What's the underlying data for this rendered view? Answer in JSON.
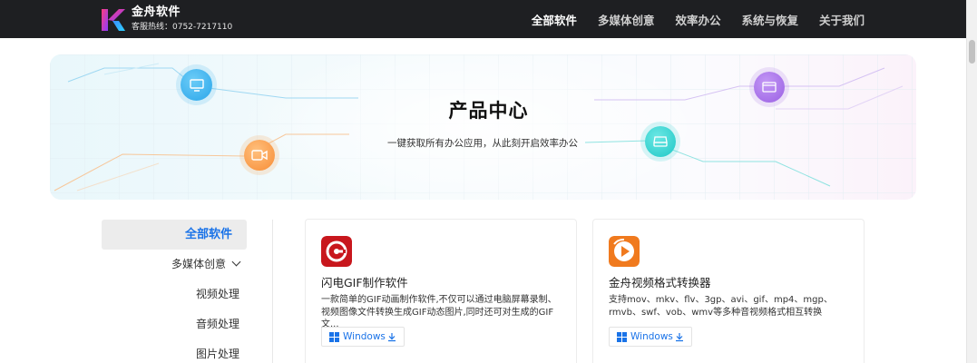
{
  "header": {
    "brand_name": "金舟软件",
    "hotline": "客服热线：0752-7217110",
    "nav": [
      "全部软件",
      "多媒体创意",
      "效率办公",
      "系统与恢复",
      "关于我们"
    ]
  },
  "banner": {
    "title": "产品中心",
    "subtitle": "一键获取所有办公应用，从此刻开启效率办公",
    "bubbles": [
      {
        "icon": "monitor-icon",
        "color": "#3db3ee"
      },
      {
        "icon": "video-camera-icon",
        "color": "#fb9a43"
      },
      {
        "icon": "hard-drive-icon",
        "color": "#2ed2d0"
      },
      {
        "icon": "browser-window-icon",
        "color": "#a56ee6"
      }
    ]
  },
  "sidebar": {
    "items": [
      {
        "label": "全部软件"
      },
      {
        "label": "多媒体创意"
      },
      {
        "label": "视频处理"
      },
      {
        "label": "音频处理"
      },
      {
        "label": "图片处理"
      }
    ]
  },
  "products": [
    {
      "title": "闪电GIF制作软件",
      "desc": "一款简单的GIF动画制作软件,不仅可以通过电脑屏幕录制、视频图像文件转换生成GIF动态图片,同时还可对生成的GIF文...",
      "download_label": "Windows",
      "icon": "gif-maker-app-icon",
      "icon_color": "#c8171d"
    },
    {
      "title": "金舟视频格式转换器",
      "desc": "支持mov、mkv、flv、3gp、avi、gif、mp4、mgp、rmvb、swf、vob、wmv等多种音视频格式相互转换",
      "download_label": "Windows",
      "icon": "video-converter-app-icon",
      "icon_color": "#f07a1e"
    }
  ],
  "colors": {
    "topbar": "#1e1f22",
    "accent": "#1a73e8"
  }
}
